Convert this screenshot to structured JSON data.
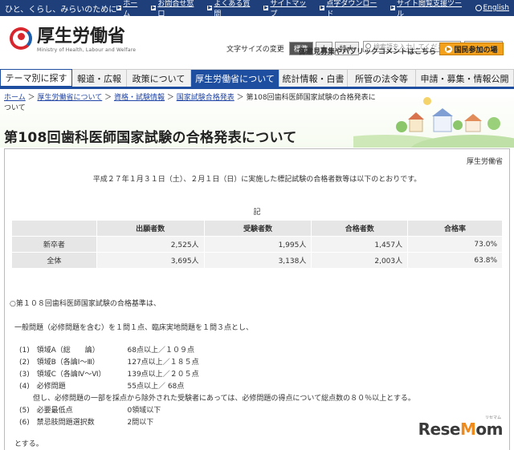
{
  "topbar": {
    "slogan": "ひと、くらし、みらいのために",
    "links": [
      "ホーム",
      "お問合せ窓口",
      "よくある質問",
      "サイトマップ",
      "点字ダウンロード",
      "サイト閲覧支援ツール",
      "English"
    ]
  },
  "header": {
    "logo_title": "厚生労働省",
    "logo_sub": "Ministry of Health, Labour and Welfare",
    "font_size_label": "文字サイズの変更",
    "font_sizes": [
      "標準",
      "大",
      "特大"
    ],
    "search_placeholder": "検索語を入力してください",
    "search_button": "検索",
    "opinion_link": "御意見募集やパブリックコメントはこちら",
    "participate_button": "国民参加の場"
  },
  "nav": {
    "items": [
      "テーマ別に探す",
      "報道・広報",
      "政策について",
      "厚生労働省について",
      "統計情報・白書",
      "所管の法令等",
      "申請・募集・情報公開"
    ]
  },
  "breadcrumb": {
    "links": [
      "ホーム",
      "厚生労働省について",
      "資格・試験情報",
      "国家試験合格発表"
    ],
    "current": "第108回歯科医師国家試験の合格発表について"
  },
  "page_title": "第108回歯科医師国家試験の合格発表について",
  "content": {
    "org": "厚生労働省",
    "intro": "平成２７年１月３１日（土）、２月１日（日）に実施した標記試験の合格者数等は以下のとおりです。",
    "ki": "記",
    "table": {
      "headers": [
        "",
        "出願者数",
        "受験者数",
        "合格者数",
        "合格率"
      ],
      "rows": [
        [
          "新卒者",
          "2,525人",
          "1,995人",
          "1,457人",
          "73.0%"
        ],
        [
          "全体",
          "3,695人",
          "3,138人",
          "2,003人",
          "63.8%"
        ]
      ]
    },
    "criteria_heading": "○第１０８回歯科医師国家試験の合格基準は、",
    "criteria_intro": "一般問題（必修問題を含む）を１問１点、臨床実地問題を１問３点とし、",
    "criteria": [
      {
        "num": "(1)",
        "label": "領域A（総　　論）",
        "value": "68点以上／１０９点"
      },
      {
        "num": "(2)",
        "label": "領域B（各論Ⅰ～Ⅲ）",
        "value": "127点以上／１８５点"
      },
      {
        "num": "(3)",
        "label": "領域C（各論Ⅳ～Ⅵ）",
        "value": "139点以上／２０５点"
      },
      {
        "num": "(4)",
        "label": "必修問題",
        "value": "55点以上／ 68点"
      }
    ],
    "criteria_note": "但し、必修問題の一部を採点から除外された受験者にあっては、必修問題の得点について総点数の８０％以上とする。",
    "criteria_extra": [
      {
        "num": "(5)",
        "label": "必要最低点",
        "value": "0領域以下"
      },
      {
        "num": "(6)",
        "label": "禁忌肢問題選択数",
        "value": "2問以下"
      }
    ],
    "closing": "とする。"
  },
  "watermark": {
    "text_a": "Rese",
    "text_o": "M",
    "text_b": "om",
    "sub": "リセマム"
  }
}
